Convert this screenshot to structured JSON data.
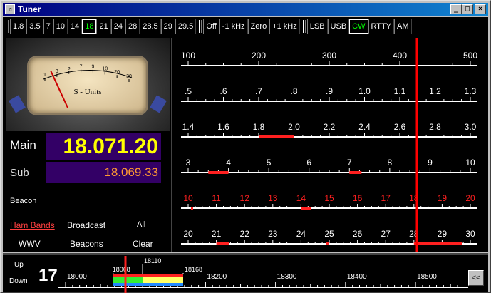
{
  "title": "Tuner",
  "window_buttons": {
    "minimize": "_",
    "maximize": "□",
    "close": "×"
  },
  "bands": [
    {
      "label": "1.8"
    },
    {
      "label": "3.5"
    },
    {
      "label": "7"
    },
    {
      "label": "10"
    },
    {
      "label": "14"
    },
    {
      "label": "18",
      "active": true
    },
    {
      "label": "21"
    },
    {
      "label": "24"
    },
    {
      "label": "28"
    },
    {
      "label": "28.5"
    },
    {
      "label": "29"
    },
    {
      "label": "29.5"
    }
  ],
  "offsets": [
    "Off",
    "-1 kHz",
    "Zero",
    "+1 kHz"
  ],
  "modes": [
    {
      "label": "LSB"
    },
    {
      "label": "USB"
    },
    {
      "label": "CW",
      "active": true
    },
    {
      "label": "RTTY"
    },
    {
      "label": "AM"
    }
  ],
  "meter": {
    "label": "S - Units",
    "scale": [
      "1",
      "3",
      "5",
      "7",
      "9",
      "10",
      "20",
      "30"
    ]
  },
  "main_label": "Main",
  "main_freq": "18.071.20",
  "sub_label": "Sub",
  "sub_freq": "18.069.33",
  "beacon_label": "Beacon",
  "links": {
    "ham_bands": "Ham Bands",
    "broadcast": "Broadcast",
    "all": "All",
    "wwv": "WWV",
    "beacons": "Beacons",
    "clear": "Clear"
  },
  "colors": {
    "freq_main": "#ffff00",
    "freq_sub": "#ff9933",
    "active": "#00ff00",
    "marker": "#ff0000",
    "readout_bg": "#330066"
  },
  "scales": [
    {
      "labels": [
        "100",
        "200",
        "300",
        "400",
        "500"
      ],
      "values": [
        100,
        200,
        300,
        400,
        500
      ],
      "lo": 100,
      "hi": 500,
      "color": "#ffffff",
      "bars": []
    },
    {
      "labels": [
        ".5",
        ".6",
        ".7",
        ".8",
        ".9",
        "1.0",
        "1.1",
        "1.2",
        "1.3"
      ],
      "values": [
        0.5,
        0.6,
        0.7,
        0.8,
        0.9,
        1.0,
        1.1,
        1.2,
        1.3
      ],
      "lo": 0.5,
      "hi": 1.3,
      "color": "#ffffff",
      "bars": []
    },
    {
      "labels": [
        "1.4",
        "1.6",
        "1.8",
        "2.0",
        "2.2",
        "2.4",
        "2.6",
        "2.8",
        "3.0"
      ],
      "values": [
        1.4,
        1.6,
        1.8,
        2.0,
        2.2,
        2.4,
        2.6,
        2.8,
        3.0
      ],
      "lo": 1.4,
      "hi": 3.0,
      "color": "#ffffff",
      "bars": [
        [
          1.8,
          2.0
        ]
      ]
    },
    {
      "labels": [
        "3",
        "4",
        "5",
        "6",
        "7",
        "8",
        "9",
        "10"
      ],
      "values": [
        3,
        4,
        5,
        6,
        7,
        8,
        9,
        10
      ],
      "lo": 3,
      "hi": 10,
      "color": "#ffffff",
      "bars": [
        [
          3.5,
          4.0
        ],
        [
          7.0,
          7.3
        ]
      ]
    },
    {
      "labels": [
        "10",
        "11",
        "12",
        "13",
        "14",
        "15",
        "16",
        "17",
        "18",
        "19",
        "20"
      ],
      "values": [
        10,
        11,
        12,
        13,
        14,
        15,
        16,
        17,
        18,
        19,
        20
      ],
      "lo": 10,
      "hi": 20,
      "color": "#ff2020",
      "bars": [
        [
          10.1,
          10.15
        ],
        [
          14.0,
          14.35
        ]
      ]
    },
    {
      "labels": [
        "20",
        "21",
        "22",
        "23",
        "24",
        "25",
        "26",
        "27",
        "28",
        "29",
        "30"
      ],
      "values": [
        20,
        21,
        22,
        23,
        24,
        25,
        26,
        27,
        28,
        29,
        30
      ],
      "lo": 20,
      "hi": 30,
      "color": "#ffffff",
      "bars": [
        [
          21.0,
          21.45
        ],
        [
          24.89,
          24.99
        ],
        [
          28.0,
          29.7
        ]
      ]
    }
  ],
  "bottom": {
    "up_label": "Up",
    "down_label": "Down",
    "band_number": "17",
    "ticks": [
      {
        "label": "18000",
        "v": 18000
      },
      {
        "label": "18200",
        "v": 18200
      },
      {
        "label": "18300",
        "v": 18300
      },
      {
        "label": "18400",
        "v": 18400
      },
      {
        "label": "18500",
        "v": 18500
      }
    ],
    "range_lo": 18000,
    "range_hi": 18560,
    "band_edges": [
      {
        "label": "18068",
        "v": 18068
      },
      {
        "label": "18110",
        "v": 18110
      },
      {
        "label": "18168",
        "v": 18168
      }
    ],
    "collapse_label": "<<"
  }
}
